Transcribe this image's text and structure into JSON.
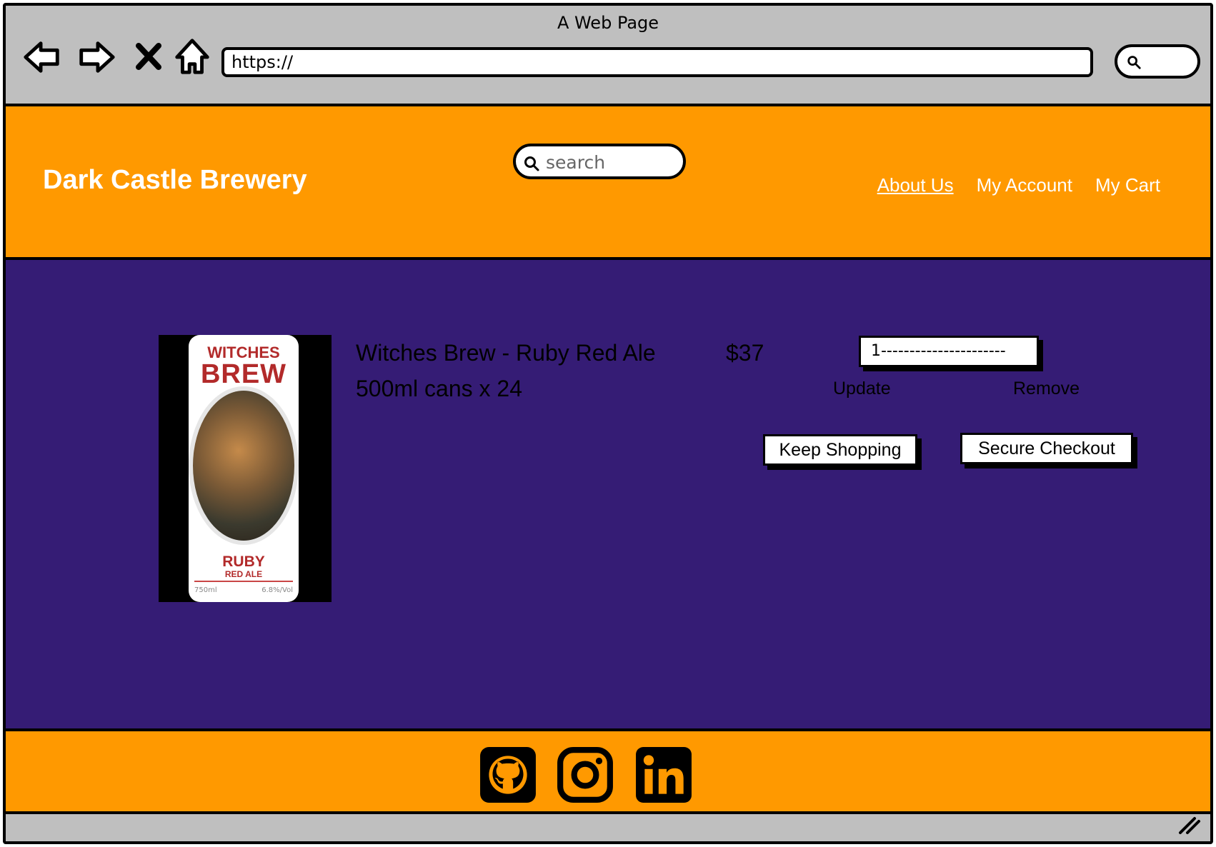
{
  "window": {
    "title": "A Web Page",
    "url": "https://",
    "nav_icons": [
      "back-arrow-icon",
      "forward-arrow-icon",
      "close-icon",
      "home-icon"
    ]
  },
  "header": {
    "brand": "Dark Castle Brewery",
    "search_placeholder": "search",
    "nav": [
      {
        "label": "About Us",
        "active": true
      },
      {
        "label": "My Account",
        "active": false
      },
      {
        "label": "My Cart",
        "active": false
      }
    ]
  },
  "cart_item": {
    "image_label": {
      "line1": "WITCHES",
      "line2": "BREW",
      "line3": "RUBY",
      "line4": "RED ALE",
      "volume": "750ml",
      "abv": "6.8%/Vol"
    },
    "name": "Witches Brew - Ruby Red Ale",
    "size": "500ml cans x 24",
    "price": "$37",
    "quantity": "1----------------------",
    "update_label": "Update",
    "remove_label": "Remove"
  },
  "actions": {
    "keep_shopping": "Keep Shopping",
    "secure_checkout": "Secure Checkout"
  },
  "footer": {
    "social_icons": [
      "github-icon",
      "instagram-icon",
      "linkedin-icon"
    ]
  },
  "colors": {
    "header_bg": "#ff9900",
    "main_bg": "#351c75",
    "chrome_bg": "#bfbfbf",
    "brand_red": "#b22a2a"
  }
}
